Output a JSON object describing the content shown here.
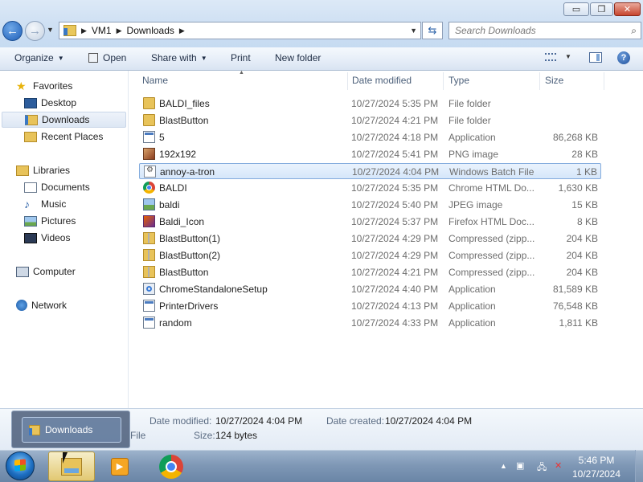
{
  "window": {
    "caption_buttons": {
      "minimize": "▭",
      "maximize": "❐",
      "close": "✕"
    },
    "breadcrumb": [
      "VM1",
      "Downloads"
    ],
    "search_placeholder": "Search Downloads"
  },
  "toolbar": {
    "organize": "Organize",
    "open": "Open",
    "share_with": "Share with",
    "print": "Print",
    "new_folder": "New folder",
    "help": "?"
  },
  "sidebar": {
    "favorites": "Favorites",
    "desktop": "Desktop",
    "downloads": "Downloads",
    "recent_places": "Recent Places",
    "libraries": "Libraries",
    "documents": "Documents",
    "music": "Music",
    "pictures": "Pictures",
    "videos": "Videos",
    "computer": "Computer",
    "network": "Network"
  },
  "columns": {
    "name": "Name",
    "date_modified": "Date modified",
    "type": "Type",
    "size": "Size"
  },
  "files": [
    {
      "name": "BALDI_files",
      "date": "10/27/2024 5:35 PM",
      "type": "File folder",
      "size": "",
      "icon": "folder"
    },
    {
      "name": "BlastButton",
      "date": "10/27/2024 4:21 PM",
      "type": "File folder",
      "size": "",
      "icon": "folder"
    },
    {
      "name": "5",
      "date": "10/27/2024 4:18 PM",
      "type": "Application",
      "size": "86,268 KB",
      "icon": "app"
    },
    {
      "name": "192x192",
      "date": "10/27/2024 5:41 PM",
      "type": "PNG image",
      "size": "28 KB",
      "icon": "png"
    },
    {
      "name": "annoy-a-tron",
      "date": "10/27/2024 4:04 PM",
      "type": "Windows Batch File",
      "size": "1 KB",
      "icon": "bat",
      "selected": true
    },
    {
      "name": "BALDI",
      "date": "10/27/2024 5:35 PM",
      "type": "Chrome HTML Do...",
      "size": "1,630 KB",
      "icon": "chrome"
    },
    {
      "name": "baldi",
      "date": "10/27/2024 5:40 PM",
      "type": "JPEG image",
      "size": "15 KB",
      "icon": "jpg"
    },
    {
      "name": "Baldi_Icon",
      "date": "10/27/2024 5:37 PM",
      "type": "Firefox HTML Doc...",
      "size": "8 KB",
      "icon": "firefox"
    },
    {
      "name": "BlastButton(1)",
      "date": "10/27/2024 4:29 PM",
      "type": "Compressed (zipp...",
      "size": "204 KB",
      "icon": "zip"
    },
    {
      "name": "BlastButton(2)",
      "date": "10/27/2024 4:29 PM",
      "type": "Compressed (zipp...",
      "size": "204 KB",
      "icon": "zip"
    },
    {
      "name": "BlastButton",
      "date": "10/27/2024 4:21 PM",
      "type": "Compressed (zipp...",
      "size": "204 KB",
      "icon": "zip"
    },
    {
      "name": "ChromeStandaloneSetup",
      "date": "10/27/2024 4:40 PM",
      "type": "Application",
      "size": "81,589 KB",
      "icon": "setup"
    },
    {
      "name": "PrinterDrivers",
      "date": "10/27/2024 4:13 PM",
      "type": "Application",
      "size": "76,548 KB",
      "icon": "app"
    },
    {
      "name": "random",
      "date": "10/27/2024 4:33 PM",
      "type": "Application",
      "size": "1,811 KB",
      "icon": "app"
    }
  ],
  "details": {
    "date_modified_label": "Date modified:",
    "date_modified_value": "10/27/2024 4:04 PM",
    "date_created_label": "Date created:",
    "date_created_value": "10/27/2024 4:04 PM",
    "type_partial": "File",
    "size_label": "Size:",
    "size_value": "124 bytes"
  },
  "thumbnail_popup": {
    "title": "Downloads"
  },
  "taskbar": {
    "clock_time": "5:46 PM",
    "clock_date": "10/27/2024",
    "tray_expand": "▲"
  }
}
